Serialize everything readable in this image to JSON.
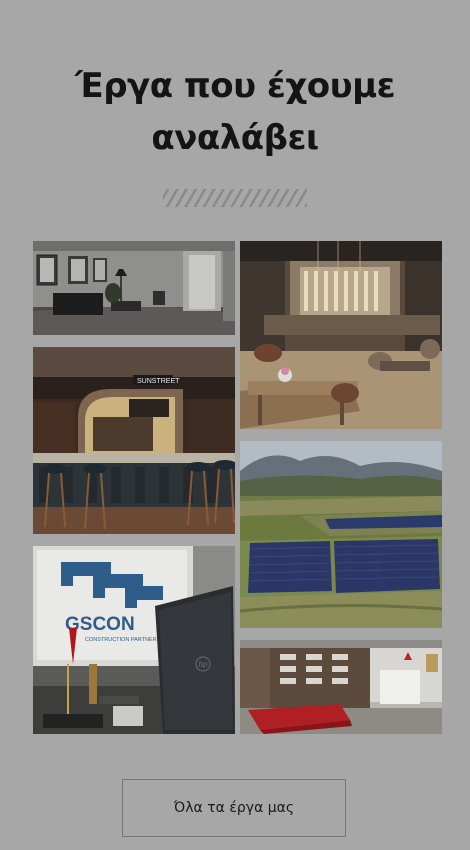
{
  "section": {
    "title_line1": "Έργα που έχουμε",
    "title_line2": "αναλάβει"
  },
  "gallery": {
    "images": [
      {
        "name": "office-interior-photo"
      },
      {
        "name": "restaurant-bar-interior-photo"
      },
      {
        "name": "bar-counter-photo"
      },
      {
        "name": "solar-park-aerial-photo"
      },
      {
        "name": "gscon-office-laptop-photo",
        "logo_text": "GSCON",
        "logo_sub": "CONSTRUCTION PARTNERS",
        "laptop_brand": "hp"
      },
      {
        "name": "showroom-interior-photo"
      }
    ]
  },
  "cta": {
    "label": "Όλα τα έργα μας"
  },
  "colors": {
    "background": "#a7a7a7",
    "title": "#141414",
    "button_border": "#777777"
  }
}
